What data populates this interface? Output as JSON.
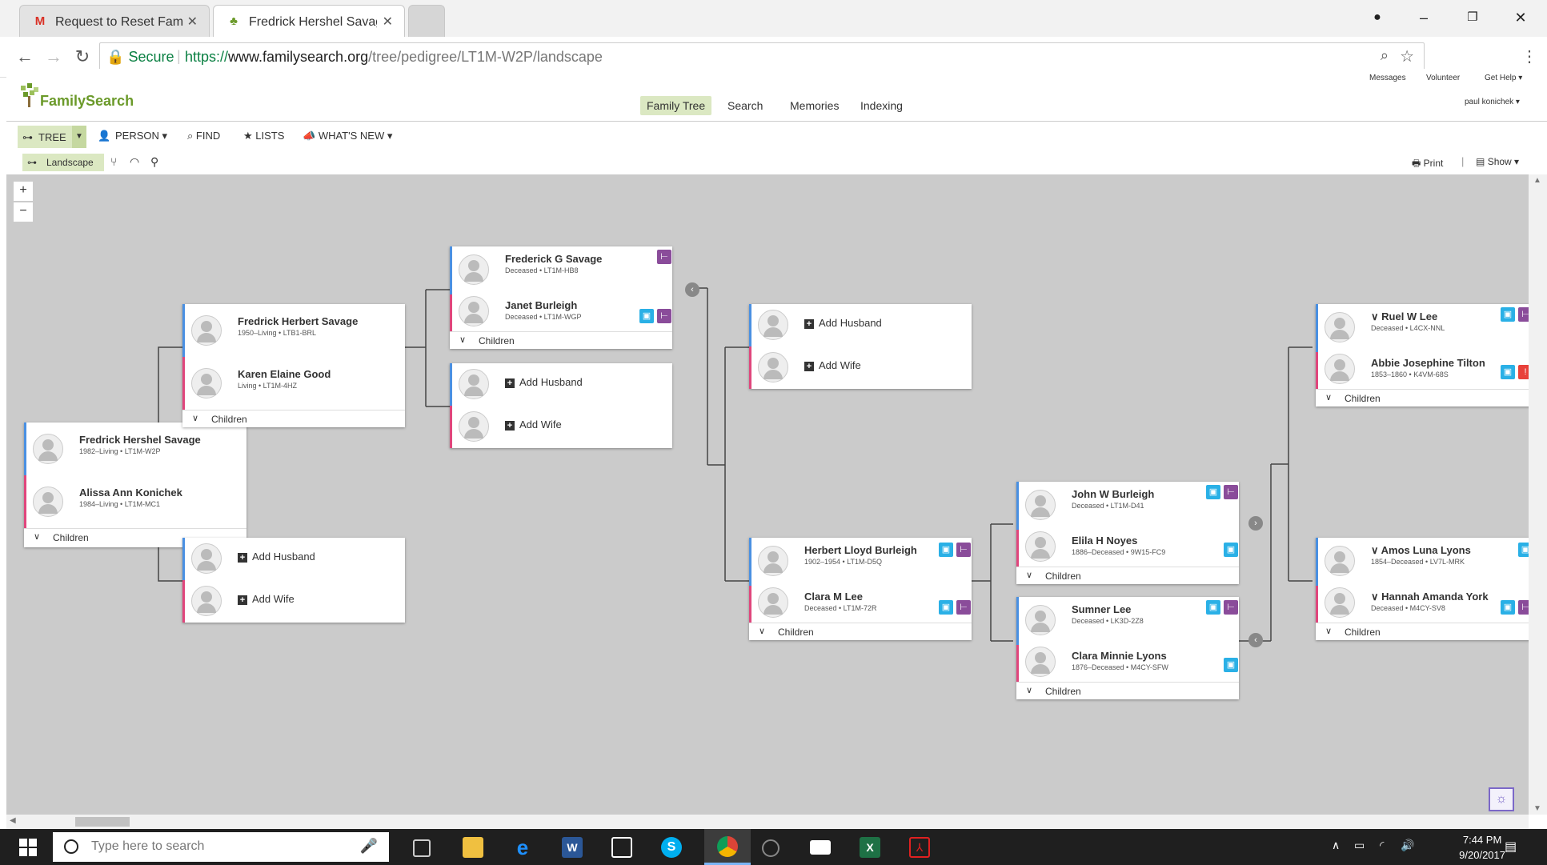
{
  "browser": {
    "tabs": [
      {
        "label": "Request to Reset FamilyS",
        "icon": "gmail-icon"
      },
      {
        "label": "Fredrick Hershel Savage",
        "icon": "familysearch-tree-icon"
      }
    ],
    "secure_label": "Secure",
    "url_scheme": "https://",
    "url_host": "www.familysearch.org",
    "url_path": "/tree/pedigree/LT1M-W2P/landscape"
  },
  "site": {
    "logo": "FamilySearch",
    "nav": [
      "Family Tree",
      "Search",
      "Memories",
      "Indexing"
    ],
    "util": {
      "messages": "Messages",
      "volunteer": "Volunteer",
      "help": "Get Help",
      "user": "paul konichek"
    }
  },
  "menu": {
    "tree": "TREE",
    "person": "PERSON",
    "find": "FIND",
    "lists": "LISTS",
    "whatsnew": "WHAT'S NEW"
  },
  "view": {
    "landscape": "Landscape",
    "print": "Print",
    "show": "Show"
  },
  "zoom": {
    "in": "+",
    "out": "−"
  },
  "labels": {
    "children": "Children",
    "add_husband": "Add Husband",
    "add_wife": "Add Wife"
  },
  "people": {
    "p1": {
      "name": "Fredrick Hershel Savage",
      "vital": "1982–Living • LT1M-W2P"
    },
    "p1s": {
      "name": "Alissa Ann Konichek",
      "vital": "1984–Living • LT1M-MC1"
    },
    "p2": {
      "name": "Fredrick Herbert Savage",
      "vital": "1950–Living • LTB1-BRL"
    },
    "p2s": {
      "name": "Karen Elaine Good",
      "vital": "Living • LT1M-4HZ"
    },
    "p3": {
      "name": "Frederick G Savage",
      "vital": "Deceased • LT1M-HB8"
    },
    "p3s": {
      "name": "Janet Burleigh",
      "vital": "Deceased • LT1M-WGP"
    },
    "p4": {
      "name": "Herbert Lloyd Burleigh",
      "vital": "1902–1954 • LT1M-D5Q"
    },
    "p4s": {
      "name": "Clara M Lee",
      "vital": "Deceased • LT1M-72R"
    },
    "p5": {
      "name": "John W Burleigh",
      "vital": "Deceased • LT1M-D41"
    },
    "p5s": {
      "name": "Elila H Noyes",
      "vital": "1886–Deceased • 9W15-FC9"
    },
    "p6": {
      "name": "Sumner Lee",
      "vital": "Deceased • LK3D-2Z8"
    },
    "p6s": {
      "name": "Clara Minnie Lyons",
      "vital": "1876–Deceased • M4CY-SFW"
    },
    "p7": {
      "name": "Ruel W Lee",
      "vital": "Deceased • L4CX-NNL"
    },
    "p7s": {
      "name": "Abbie Josephine Tilton",
      "vital": "1853–1860 • K4VM-68S"
    },
    "p8": {
      "name": "Amos Luna Lyons",
      "vital": "1854–Deceased • LV7L-MRK"
    },
    "p8s": {
      "name": "Hannah Amanda York",
      "vital": "Deceased • M4CY-SV8"
    }
  },
  "taskbar": {
    "search_placeholder": "Type here to search",
    "time": "7:44 PM",
    "date": "9/20/2017"
  },
  "colors": {
    "male": "#4a90e2",
    "female": "#e0467c",
    "canvas": "#cbcbcb",
    "active_nav": "#dbe8c2"
  }
}
